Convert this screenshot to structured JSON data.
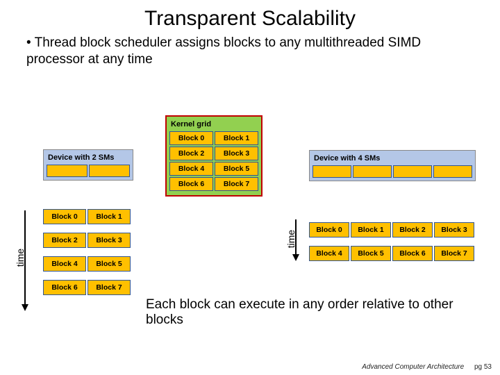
{
  "title": "Transparent Scalability",
  "bullet": "• Thread block scheduler assigns blocks to any multithreaded SIMD processor  at any time",
  "kernel": {
    "title": "Kernel grid",
    "rows": [
      [
        "Block 0",
        "Block 1"
      ],
      [
        "Block 2",
        "Block 3"
      ],
      [
        "Block 4",
        "Block 5"
      ],
      [
        "Block 6",
        "Block 7"
      ]
    ]
  },
  "device2": {
    "title": "Device with 2 SMs"
  },
  "device4": {
    "title": "Device with 4 SMs"
  },
  "sched2": {
    "rows": [
      [
        "Block 0",
        "Block 1"
      ],
      [
        "Block 2",
        "Block 3"
      ],
      [
        "Block 4",
        "Block 5"
      ],
      [
        "Block 6",
        "Block 7"
      ]
    ]
  },
  "sched4": {
    "rows": [
      [
        "Block 0",
        "Block 1",
        "Block 2",
        "Block 3"
      ],
      [
        "Block 4",
        "Block 5",
        "Block 6",
        "Block 7"
      ]
    ]
  },
  "time_label": "time",
  "caption": "Each block can execute in any order relative to other blocks",
  "footer": {
    "course": "Advanced Computer Architecture",
    "page": "pg 53"
  }
}
